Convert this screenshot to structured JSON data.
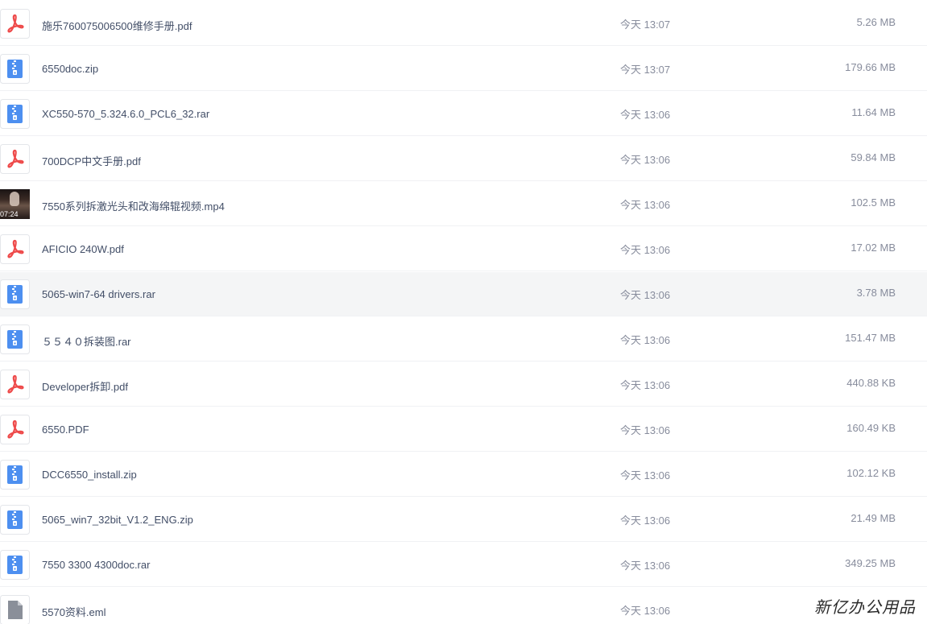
{
  "files": [
    {
      "name": "施乐760075006500维修手册.pdf",
      "time": "今天 13:07",
      "size": "5.26 MB",
      "icon": "pdf-icon"
    },
    {
      "name": "6550doc.zip",
      "time": "今天 13:07",
      "size": "179.66 MB",
      "icon": "zip-icon"
    },
    {
      "name": "XC550-570_5.324.6.0_PCL6_32.rar",
      "time": "今天 13:06",
      "size": "11.64 MB",
      "icon": "zip-icon"
    },
    {
      "name": "700DCP中文手册.pdf",
      "time": "今天 13:06",
      "size": "59.84 MB",
      "icon": "pdf-icon"
    },
    {
      "name": "7550系列拆激光头和改海绵辊视频.mp4",
      "time": "今天 13:06",
      "size": "102.5 MB",
      "icon": "video-thumbnail",
      "duration": "07:24"
    },
    {
      "name": "AFICIO 240W.pdf",
      "time": "今天 13:06",
      "size": "17.02 MB",
      "icon": "pdf-icon"
    },
    {
      "name": "5065-win7-64 drivers.rar",
      "time": "今天 13:06",
      "size": "3.78 MB",
      "icon": "zip-icon",
      "hovered": true
    },
    {
      "name": "５５４０拆装图.rar",
      "time": "今天 13:06",
      "size": "151.47 MB",
      "icon": "zip-icon"
    },
    {
      "name": "Developer拆卸.pdf",
      "time": "今天 13:06",
      "size": "440.88 KB",
      "icon": "pdf-icon"
    },
    {
      "name": "6550.PDF",
      "time": "今天 13:06",
      "size": "160.49 KB",
      "icon": "pdf-icon"
    },
    {
      "name": "DCC6550_install.zip",
      "time": "今天 13:06",
      "size": "102.12 KB",
      "icon": "zip-icon"
    },
    {
      "name": "5065_win7_32bit_V1.2_ENG.zip",
      "time": "今天 13:06",
      "size": "21.49 MB",
      "icon": "zip-icon"
    },
    {
      "name": "7550 3300 4300doc.rar",
      "time": "今天 13:06",
      "size": "349.25 MB",
      "icon": "zip-icon"
    },
    {
      "name": "5570资料.eml",
      "time": "今天 13:06",
      "size": "",
      "icon": "document-icon"
    }
  ],
  "watermark": "新亿办公用品",
  "colors": {
    "pdf": "#ee4a4a",
    "zip": "#4d8ff0",
    "doc": "#8a8f99",
    "hover": "#f4f5f6"
  }
}
